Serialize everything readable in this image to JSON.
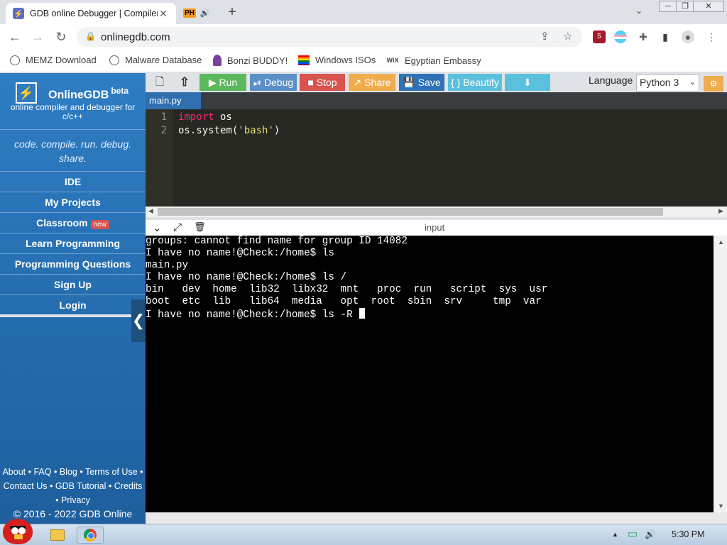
{
  "browser": {
    "tabs": [
      {
        "title": "GDB online Debugger | Compiler",
        "favicon": "onlinegdb-bolt-icon",
        "active": true
      },
      {
        "title": "",
        "favicon": "ph-icon",
        "audio": true,
        "active": false
      }
    ],
    "favicon_glyph": "⚡",
    "tab_close_glyph": "✕",
    "ph_label": "PH",
    "speaker_glyph": "🔊",
    "new_tab_glyph": "+",
    "tab_list_glyph": "⌄",
    "window_controls": {
      "minimize": "─",
      "restore": "❐",
      "close": "✕"
    },
    "nav": {
      "back": "←",
      "forward": "→",
      "reload": "↻"
    },
    "url": "onlinegdb.com",
    "lock_glyph": "🔒",
    "share_glyph": "⇪",
    "star_glyph": "☆",
    "extensions": {
      "ublock_badge": "5",
      "puzzle_glyph": "✚",
      "sidepanel_glyph": "▮",
      "profile_glyph": "●",
      "menu_glyph": "⋮"
    },
    "bookmarks": [
      {
        "label": "MEMZ Download",
        "icon": "globe-icon"
      },
      {
        "label": "Malware Database",
        "icon": "globe-icon"
      },
      {
        "label": "Bonzi BUDDY!",
        "icon": "bonzi-icon"
      },
      {
        "label": "Windows ISOs",
        "icon": "rainbow-flag-icon"
      },
      {
        "label": "Egyptian Embassy",
        "icon": "wix-icon"
      }
    ],
    "wix_label": "WiX"
  },
  "sidebar": {
    "logo_glyph": "⚡",
    "brand": "OnlineGDB",
    "brand_sup": "beta",
    "tagline": "online compiler and debugger for c/c++",
    "motto": "code. compile. run. debug. share.",
    "nav": [
      "IDE",
      "My Projects",
      "Classroom",
      "Learn Programming",
      "Programming Questions",
      "Sign Up",
      "Login"
    ],
    "classroom_badge": "new",
    "collapse_glyph": "❮",
    "footer_links": [
      "About",
      "FAQ",
      "Blog",
      "Terms of Use",
      "Contact Us",
      "GDB Tutorial",
      "Credits",
      "Privacy"
    ],
    "footer_sep": "•",
    "copyright": "© 2016 - 2022 GDB Online"
  },
  "ide": {
    "toolbar": {
      "new_file_glyph": "🗋",
      "upload_glyph": "⇧",
      "run": "Run",
      "run_glyph": "▶",
      "debug": "Debug",
      "debug_glyph": "⏯",
      "stop": "Stop",
      "stop_glyph": "■",
      "share": "Share",
      "share_glyph": "↗",
      "save": "Save",
      "save_glyph": "💾",
      "beautify": "Beautify",
      "beautify_glyph": "{ }",
      "download_glyph": "⬇",
      "colors": {
        "run": "#5cb85c",
        "debug": "#5b8fc7",
        "stop": "#d9534f",
        "share": "#f0ad4e",
        "save": "#2f72b7",
        "beautify": "#5bc0de",
        "download": "#5bc0de"
      }
    },
    "language_label": "Language",
    "language_value": "Python 3",
    "language_caret": "⌄",
    "settings_glyph": "⚙",
    "file_tab": "main.py",
    "code": [
      {
        "line": "1",
        "parts": [
          {
            "t": "import",
            "c": "kw"
          },
          {
            "t": " os",
            "c": ""
          }
        ]
      },
      {
        "line": "2",
        "parts": [
          {
            "t": "os.system(",
            "c": ""
          },
          {
            "t": "'bash'",
            "c": "str"
          },
          {
            "t": ")",
            "c": ""
          }
        ]
      }
    ],
    "scroll_left": "◀",
    "scroll_right": "▶",
    "scroll_up": "▲",
    "scroll_down": "▼"
  },
  "terminal": {
    "title": "input",
    "header_icons": {
      "collapse": "⌄",
      "expand": "⤢",
      "clear": "🗑"
    },
    "lines": [
      "groups: cannot find name for group ID 14082",
      "I have no name!@Check:/home$ ls",
      "main.py",
      "I have no name!@Check:/home$ ls /",
      "bin   dev  home  lib32  libx32  mnt   proc  run   script  sys  usr",
      "boot  etc  lib   lib64  media   opt  root  sbin  srv     tmp  var",
      "I have no name!@Check:/home$ ls -R "
    ]
  },
  "taskbar": {
    "apps": [
      {
        "name": "file-explorer"
      },
      {
        "name": "chrome",
        "active": true
      }
    ],
    "tray": {
      "up_glyph": "▲",
      "battery_glyph": "▭",
      "volume_glyph": "🔊"
    },
    "clock": "5:30 PM"
  }
}
